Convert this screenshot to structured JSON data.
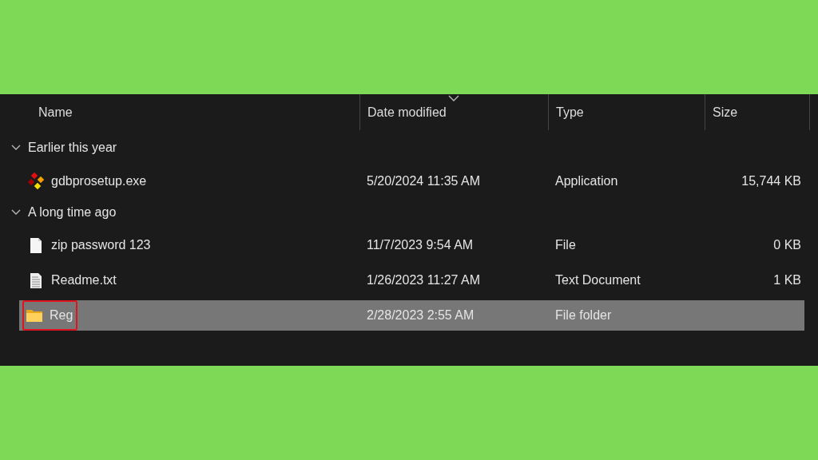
{
  "columns": [
    {
      "label": "Name",
      "sorted": false
    },
    {
      "label": "Date modified",
      "sorted": true
    },
    {
      "label": "Type",
      "sorted": false
    },
    {
      "label": "Size",
      "sorted": false
    }
  ],
  "groups": [
    {
      "label": "Earlier this year",
      "expanded": true,
      "items": [
        {
          "kind": "exe",
          "name": "gdbprosetup.exe",
          "date": "5/20/2024 11:35 AM",
          "type": "Application",
          "size": "15,744 KB",
          "selected": false,
          "highlighted": false
        }
      ]
    },
    {
      "label": "A long time ago",
      "expanded": true,
      "items": [
        {
          "kind": "file",
          "name": "zip password 123",
          "date": "11/7/2023 9:54 AM",
          "type": "File",
          "size": "0 KB",
          "selected": false,
          "highlighted": false
        },
        {
          "kind": "text",
          "name": "Readme.txt",
          "date": "1/26/2023 11:27 AM",
          "type": "Text Document",
          "size": "1 KB",
          "selected": false,
          "highlighted": false
        },
        {
          "kind": "folder",
          "name": "Reg",
          "date": "2/28/2023 2:55 AM",
          "type": "File folder",
          "selected": true,
          "highlighted": true
        }
      ]
    }
  ]
}
